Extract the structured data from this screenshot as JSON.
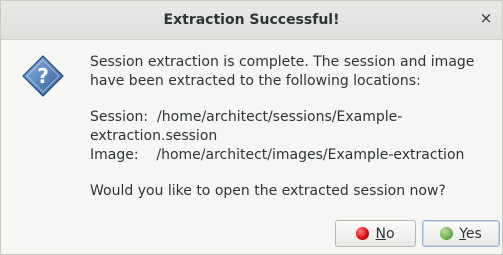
{
  "dialog": {
    "title": "Extraction Successful!",
    "close_glyph": "×",
    "icon": "question-icon",
    "message": "Session extraction is complete. The session and image have been extracted to the following locations:",
    "session_label": "Session:",
    "session_path": "/home/architect/sessions/Example-extraction.session",
    "image_label": "Image:",
    "image_path": "/home/architect/images/Example-extraction",
    "question": "Would you like to open the extracted session now?",
    "buttons": {
      "no": {
        "mnemonic": "N",
        "rest": "o"
      },
      "yes": {
        "mnemonic": "Y",
        "rest": "es"
      }
    }
  },
  "colors": {
    "no_dot": "#d40000",
    "yes_dot": "#6aa84f",
    "icon_blue": "#3465a4"
  }
}
